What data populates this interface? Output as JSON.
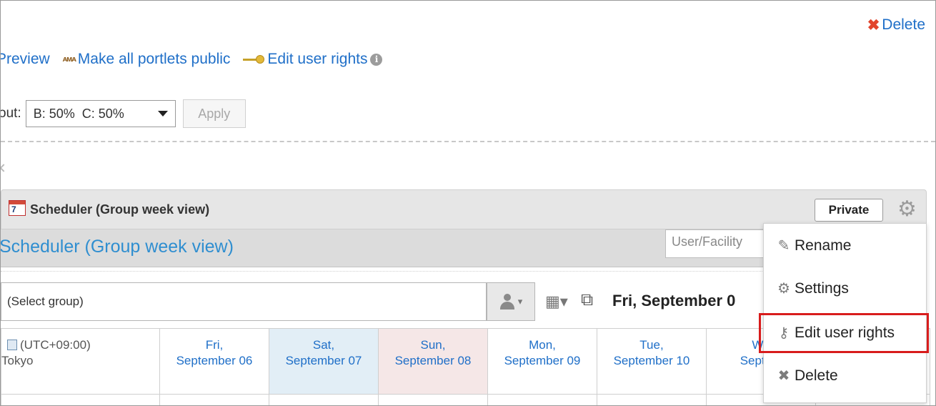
{
  "header": {
    "delete_label": "Delete",
    "preview_label": "Preview",
    "make_public_label": "Make all portlets public",
    "edit_rights_label": "Edit user rights",
    "colors": {
      "link": "#1f6fc8",
      "delete_x": "#e2442c",
      "highlight": "#d81c1c"
    }
  },
  "layout": {
    "label": "out:",
    "selected": "B: 50%  C: 50%",
    "apply_label": "Apply"
  },
  "portlet": {
    "calendar_icon_text": "7",
    "title": "Scheduler (Group week view)",
    "private_label": "Private",
    "subtitle": "Scheduler (Group week view)",
    "user_facility_placeholder": "User/Facility",
    "group_select": "(Select group)",
    "date_title": "Fri, September 0"
  },
  "calendar": {
    "timezone_line1": "(UTC+09:00)",
    "timezone_line2": "Tokyo",
    "days": [
      {
        "day": "Fri,",
        "date": "September 06",
        "type": "weekday"
      },
      {
        "day": "Sat,",
        "date": "September 07",
        "type": "sat"
      },
      {
        "day": "Sun,",
        "date": "September 08",
        "type": "sun"
      },
      {
        "day": "Mon,",
        "date": "September 09",
        "type": "weekday"
      },
      {
        "day": "Tue,",
        "date": "September 10",
        "type": "weekday"
      },
      {
        "day": "We",
        "date": "Septem",
        "type": "weekday"
      }
    ]
  },
  "menu": {
    "items": [
      {
        "label": "Rename",
        "icon": "pencil-icon"
      },
      {
        "label": "Settings",
        "icon": "gear-icon"
      },
      {
        "label": "Edit user rights",
        "icon": "key-icon"
      },
      {
        "label": "Delete",
        "icon": "close-icon"
      }
    ]
  }
}
